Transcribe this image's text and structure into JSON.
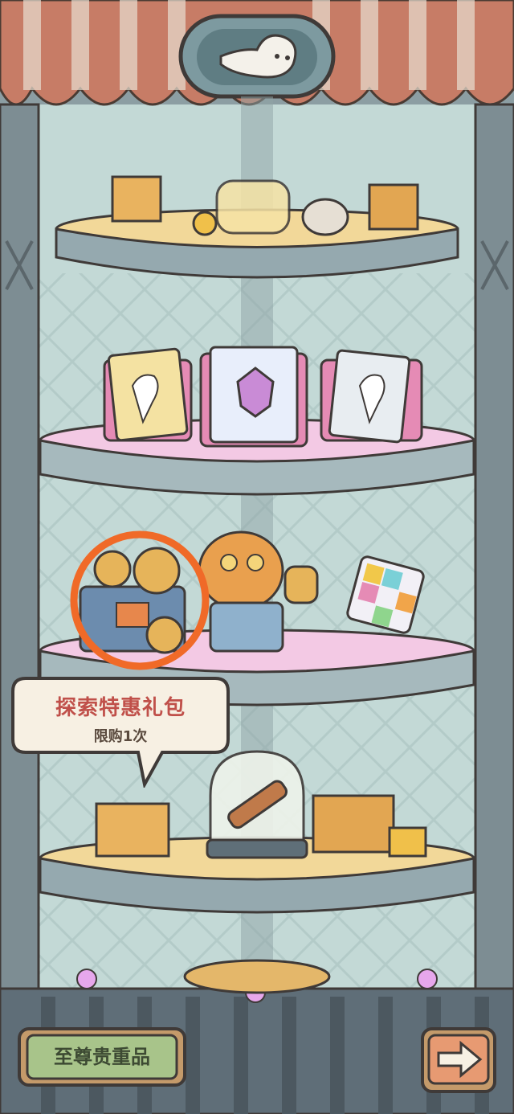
{
  "bubble": {
    "title": "探索特惠礼包",
    "subtitle": "限购1次"
  },
  "bottom_bar": {
    "premium_label": "至尊贵重品",
    "next_icon": "arrow-right-icon"
  },
  "colors": {
    "highlight_ring": "#f06a28",
    "bubble_title": "#c0504a",
    "premium_button": "#a8c48a",
    "next_button": "#e79a72"
  },
  "shelves": [
    {
      "items": [
        "gift-bag",
        "lamp-dome",
        "fox-skull",
        "coins",
        "gift-box"
      ]
    },
    {
      "items": [
        "ghost-card-gold",
        "crystal-card-purple",
        "ghost-card-white"
      ]
    },
    {
      "items": [
        "film-projector",
        "robot-cat",
        "rubik-cube"
      ]
    },
    {
      "items": [
        "gift-bag",
        "telescope-dome",
        "gift-box"
      ]
    }
  ],
  "highlight": {
    "target": "film-projector"
  }
}
